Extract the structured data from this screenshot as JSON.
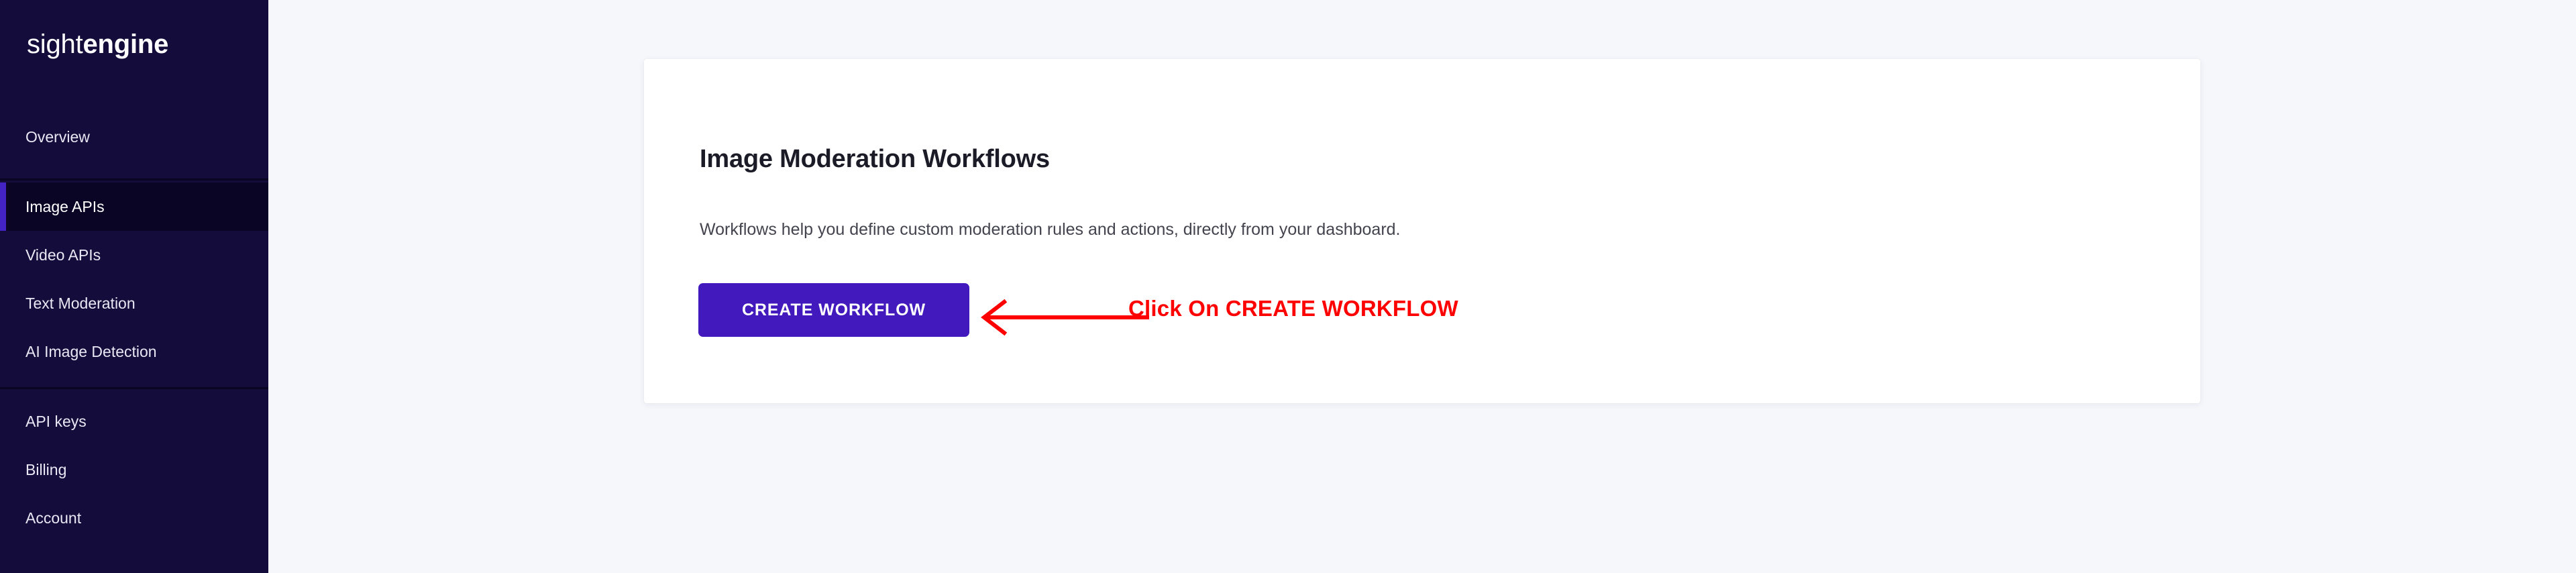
{
  "sidebar": {
    "logo": {
      "light_part": "sight",
      "bold_part": "engine",
      "full_text": "sightengine"
    },
    "groups": [
      {
        "name": "primary",
        "items": [
          {
            "label": "Overview",
            "active": false
          }
        ]
      },
      {
        "name": "products",
        "items": [
          {
            "label": "Image APIs",
            "active": true
          },
          {
            "label": "Video APIs",
            "active": false
          },
          {
            "label": "Text Moderation",
            "active": false
          },
          {
            "label": "AI Image Detection",
            "active": false
          }
        ]
      },
      {
        "name": "account",
        "items": [
          {
            "label": "API keys",
            "active": false
          },
          {
            "label": "Billing",
            "active": false
          },
          {
            "label": "Account",
            "active": false
          }
        ]
      }
    ]
  },
  "main": {
    "card": {
      "title": "Image Moderation Workflows",
      "description": "Workflows help you define custom moderation rules and actions, directly from your dashboard.",
      "primary_button_label": "CREATE WORKFLOW"
    }
  },
  "annotation": {
    "text": "Click On CREATE WORKFLOW",
    "arrow_direction": "left",
    "color": "#ff0000"
  },
  "colors": {
    "sidebar_bg": "#140c3a",
    "sidebar_active_bg": "#0a0425",
    "sidebar_active_bar": "#4423c4",
    "page_bg": "#f6f7fb",
    "card_bg": "#ffffff",
    "button_purple": "#4219bd",
    "annotation_red": "#ff0000",
    "title_text": "#1b1b27",
    "body_text": "#44444f"
  }
}
